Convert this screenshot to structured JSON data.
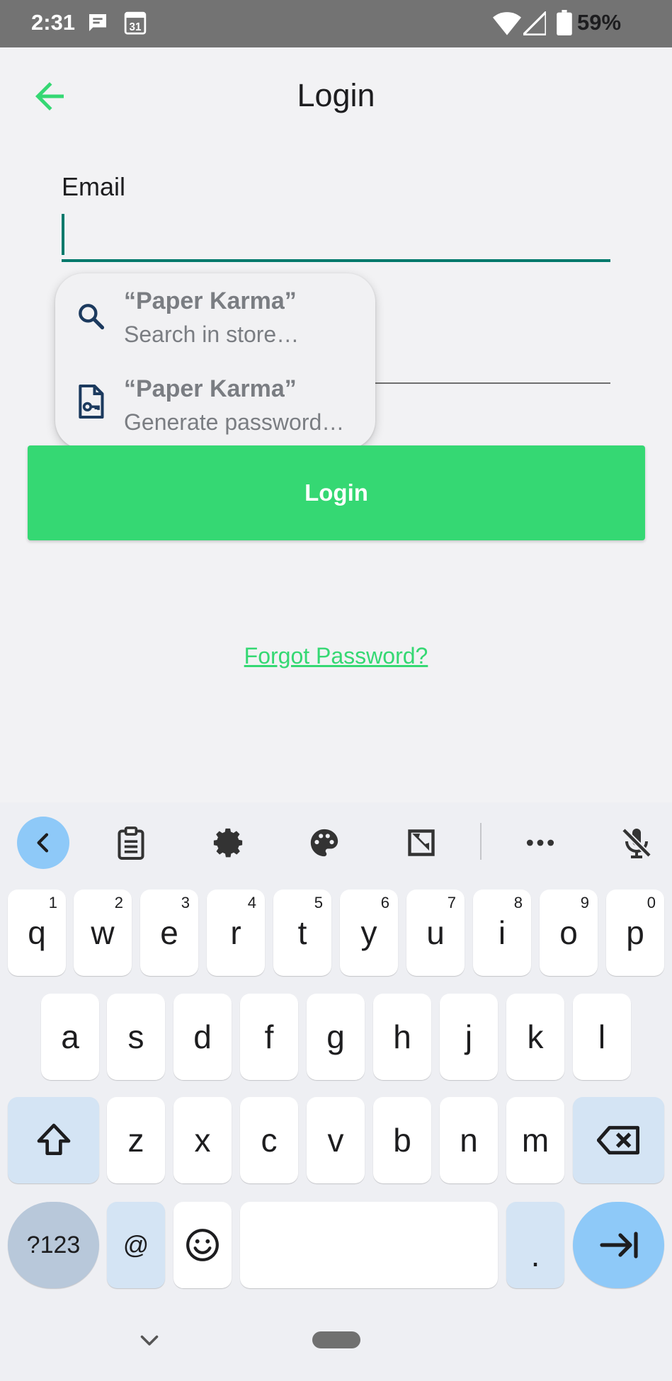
{
  "status_bar": {
    "time": "2:31",
    "battery": "59%"
  },
  "header": {
    "title": "Login"
  },
  "form": {
    "email_label": "Email",
    "email_value": "",
    "password_value": ""
  },
  "autofill": {
    "items": [
      {
        "title": "“Paper Karma”",
        "subtitle": "Search in store…",
        "icon": "search-icon"
      },
      {
        "title": "“Paper Karma”",
        "subtitle": "Generate password…",
        "icon": "password-key-icon"
      }
    ]
  },
  "actions": {
    "login_label": "Login",
    "forgot_label": "Forgot Password?"
  },
  "colors": {
    "accent": "#35d873",
    "focus": "#00796b",
    "status_bar": "#737373"
  },
  "keyboard": {
    "row1": [
      "q",
      "w",
      "e",
      "r",
      "t",
      "y",
      "u",
      "i",
      "o",
      "p"
    ],
    "row1_hints": [
      "1",
      "2",
      "3",
      "4",
      "5",
      "6",
      "7",
      "8",
      "9",
      "0"
    ],
    "row2": [
      "a",
      "s",
      "d",
      "f",
      "g",
      "h",
      "j",
      "k",
      "l"
    ],
    "row3": [
      "z",
      "x",
      "c",
      "v",
      "b",
      "n",
      "m"
    ],
    "symbols_label": "?123",
    "at_label": "@",
    "period_label": "."
  }
}
